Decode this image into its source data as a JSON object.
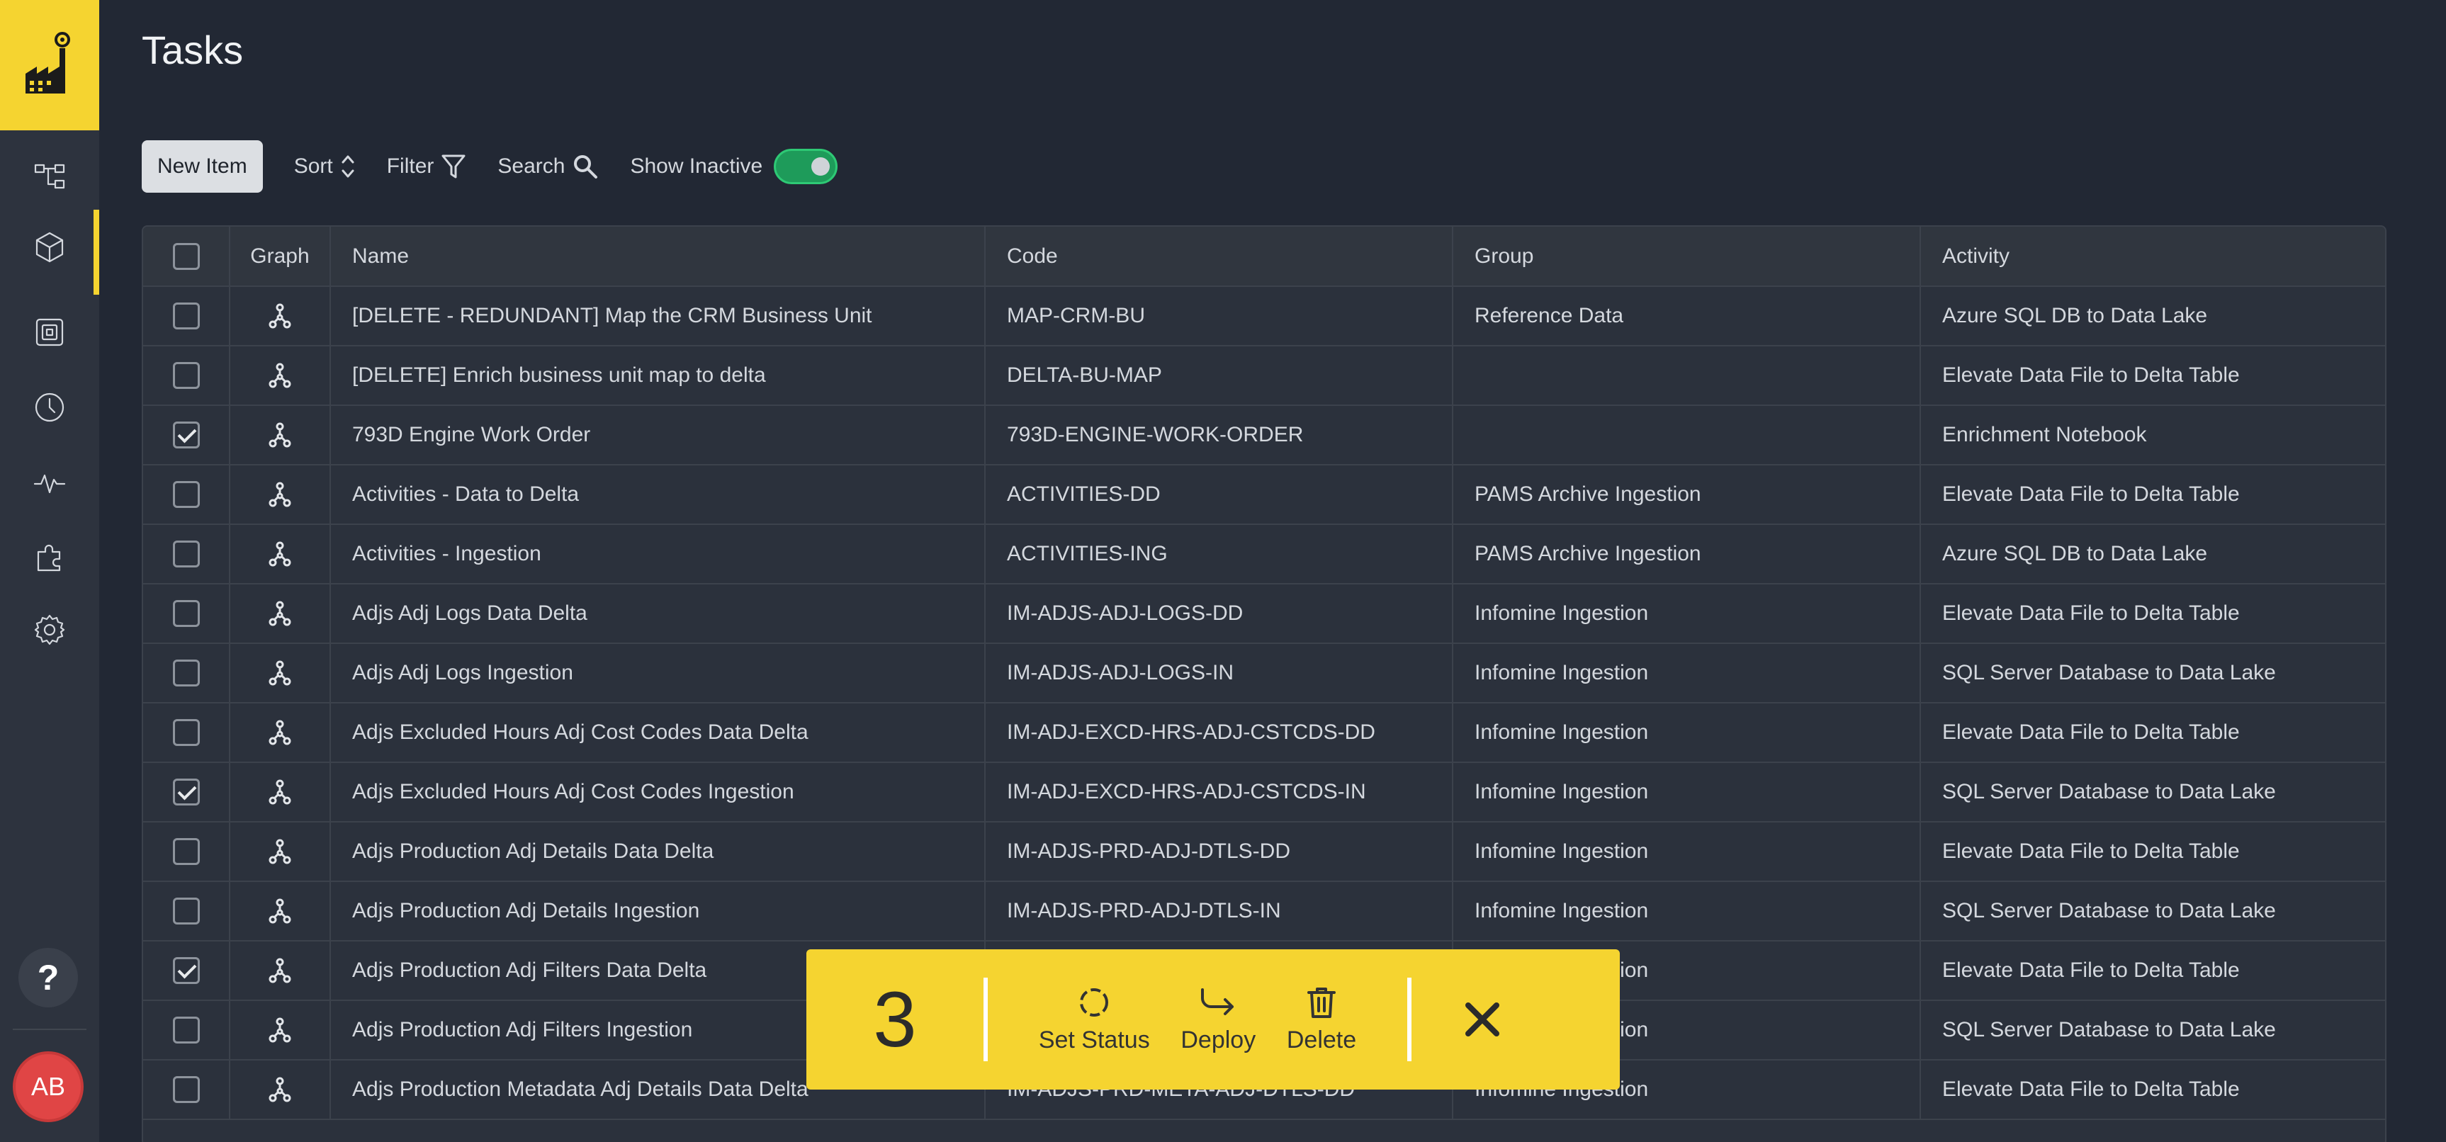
{
  "app": {
    "user_initials": "AB",
    "help_label": "?"
  },
  "page": {
    "title": "Tasks"
  },
  "nav": [
    {
      "icon": "flow-icon"
    },
    {
      "icon": "cube-icon",
      "active": true
    },
    {
      "icon": "layers-icon"
    },
    {
      "icon": "clock-icon"
    },
    {
      "icon": "pulse-icon"
    },
    {
      "icon": "puzzle-icon"
    },
    {
      "icon": "gear-icon"
    }
  ],
  "toolbar": {
    "new_item": "New Item",
    "sort": "Sort",
    "filter": "Filter",
    "search": "Search",
    "show_inactive": "Show Inactive",
    "show_inactive_on": true
  },
  "table": {
    "headers": {
      "graph": "Graph",
      "name": "Name",
      "code": "Code",
      "group": "Group",
      "activity": "Activity"
    },
    "rows": [
      {
        "checked": false,
        "name": "[DELETE - REDUNDANT] Map the CRM Business Unit",
        "code": "MAP-CRM-BU",
        "group": "Reference Data",
        "activity": "Azure SQL DB to Data Lake"
      },
      {
        "checked": false,
        "name": "[DELETE] Enrich business unit map to delta",
        "code": "DELTA-BU-MAP",
        "group": "",
        "activity": "Elevate Data File to Delta Table"
      },
      {
        "checked": true,
        "name": "793D Engine Work Order",
        "code": "793D-ENGINE-WORK-ORDER",
        "group": "",
        "activity": "Enrichment Notebook"
      },
      {
        "checked": false,
        "name": "Activities - Data to Delta",
        "code": "ACTIVITIES-DD",
        "group": "PAMS Archive Ingestion",
        "activity": "Elevate Data File to Delta Table"
      },
      {
        "checked": false,
        "name": "Activities - Ingestion",
        "code": "ACTIVITIES-ING",
        "group": "PAMS Archive Ingestion",
        "activity": "Azure SQL DB to Data Lake"
      },
      {
        "checked": false,
        "name": "Adjs Adj Logs Data Delta",
        "code": "IM-ADJS-ADJ-LOGS-DD",
        "group": "Infomine Ingestion",
        "activity": "Elevate Data File to Delta Table"
      },
      {
        "checked": false,
        "name": "Adjs Adj Logs Ingestion",
        "code": "IM-ADJS-ADJ-LOGS-IN",
        "group": "Infomine Ingestion",
        "activity": "SQL Server Database to Data Lake"
      },
      {
        "checked": false,
        "name": "Adjs Excluded Hours Adj Cost Codes Data Delta",
        "code": "IM-ADJ-EXCD-HRS-ADJ-CSTCDS-DD",
        "group": "Infomine Ingestion",
        "activity": "Elevate Data File to Delta Table"
      },
      {
        "checked": true,
        "name": "Adjs Excluded Hours Adj Cost Codes Ingestion",
        "code": "IM-ADJ-EXCD-HRS-ADJ-CSTCDS-IN",
        "group": "Infomine Ingestion",
        "activity": "SQL Server Database to Data Lake"
      },
      {
        "checked": false,
        "name": "Adjs Production Adj Details Data Delta",
        "code": "IM-ADJS-PRD-ADJ-DTLS-DD",
        "group": "Infomine Ingestion",
        "activity": "Elevate Data File to Delta Table"
      },
      {
        "checked": false,
        "name": "Adjs Production Adj Details Ingestion",
        "code": "IM-ADJS-PRD-ADJ-DTLS-IN",
        "group": "Infomine Ingestion",
        "activity": "SQL Server Database to Data Lake"
      },
      {
        "checked": true,
        "name": "Adjs Production Adj Filters Data Delta",
        "code": "",
        "group": "Infomine Ingestion",
        "activity": "Elevate Data File to Delta Table"
      },
      {
        "checked": false,
        "name": "Adjs Production Adj Filters Ingestion",
        "code": "",
        "group": "Infomine Ingestion",
        "activity": "SQL Server Database to Data Lake"
      },
      {
        "checked": false,
        "name": "Adjs Production Metadata Adj Details Data Delta",
        "code": "IM-ADJS-PRD-META-ADJ-DTLS-DD",
        "group": "Infomine Ingestion",
        "activity": "Elevate Data File to Delta Table"
      }
    ]
  },
  "action_bar": {
    "count": "3",
    "set_status": "Set Status",
    "deploy": "Deploy",
    "delete": "Delete"
  },
  "colors": {
    "accent": "#f5d430",
    "toggle_on": "#1e9b5a",
    "avatar": "#e04545",
    "background": "#222834"
  }
}
